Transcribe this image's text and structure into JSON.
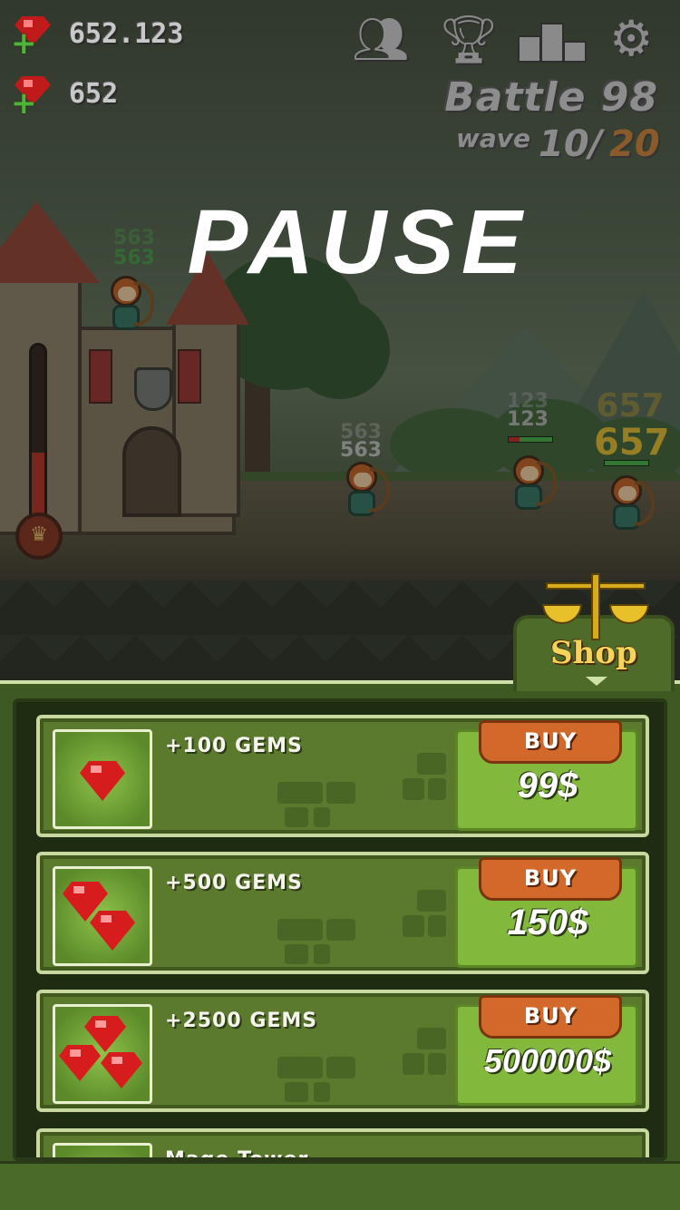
{
  "hud": {
    "gems_total": "652.123",
    "gems_small": "652",
    "icons": [
      "friends-icon",
      "trophy-icon",
      "leaderboard-icon",
      "gear-icon"
    ],
    "battle_label": "Battle 98",
    "wave_label": "wave",
    "wave_current": "10/",
    "wave_max": "20"
  },
  "pause_text": "PAUSE",
  "scene": {
    "castle_damage_1": "563",
    "castle_damage_2": "563",
    "enemy1_damage_1": "563",
    "enemy1_damage_2": "563",
    "enemy2_damage_1": "123",
    "enemy2_damage_2": "123",
    "enemy3_damage_1": "657",
    "enemy3_damage_2": "657"
  },
  "shop": {
    "tab_label": "Shop",
    "items": [
      {
        "title": "+100 GEMS",
        "buy_label": "BUY",
        "price": "99$"
      },
      {
        "title": "+500 GEMS",
        "buy_label": "BUY",
        "price": "150$"
      },
      {
        "title": "+2500 GEMS",
        "buy_label": "BUY",
        "price": "500000$"
      },
      {
        "title": "Mage Tower"
      }
    ]
  },
  "colors": {
    "panel_green": "#3e5a22",
    "card_green": "#5b7a2e",
    "buy_orange": "#d2692a",
    "gem_red": "#d61c1c",
    "gold": "#d8ab1c"
  }
}
